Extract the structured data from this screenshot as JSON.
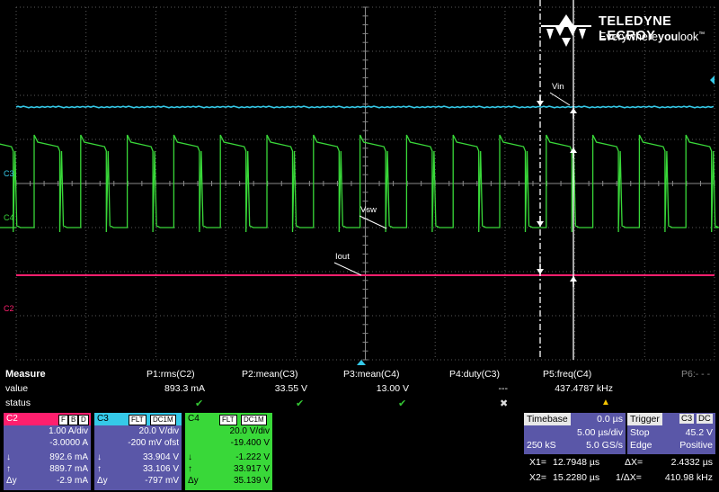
{
  "brand": {
    "name": "TELEDYNE LECROY",
    "tagline_pre": "Everywhere",
    "tagline_bold": "you",
    "tagline_post": "look",
    "tagline_tm": "™"
  },
  "colors": {
    "c2": "#ff1f6e",
    "c3": "#35c9e8",
    "c4": "#39d839",
    "grid": "#5a5a5a",
    "panel": "#5a57a8"
  },
  "traces": {
    "c3_label": "C3",
    "c4_label": "C4",
    "c2_label": "C2",
    "vin_label": "Vin",
    "vsw_label": "Vsw",
    "iout_label": "Iout"
  },
  "measure": {
    "title": "Measure",
    "row_value": "value",
    "row_status": "status",
    "params": [
      {
        "name": "P1:rms(C2)",
        "value": "893.3 mA",
        "status": "check"
      },
      {
        "name": "P2:mean(C3)",
        "value": "33.55 V",
        "status": "check"
      },
      {
        "name": "P3:mean(C4)",
        "value": "13.00 V",
        "status": "check"
      },
      {
        "name": "P4:duty(C3)",
        "value": "---",
        "status": "cross"
      },
      {
        "name": "P5:freq(C4)",
        "value": "437.4787 kHz",
        "status": "warn"
      },
      {
        "name": "P6:- - -",
        "value": "",
        "status": ""
      }
    ]
  },
  "channels": [
    {
      "name": "C2",
      "badges": [
        "F",
        "B",
        "D"
      ],
      "vdiv": "1.00 A/div",
      "offset": "-3.0000 A",
      "down": "892.6 mA",
      "up": "889.7 mA",
      "delta": "-2.9 mA"
    },
    {
      "name": "C3",
      "badges": [
        "FLT",
        "DC1M"
      ],
      "vdiv": "20.0 V/div",
      "offset": "-200 mV ofst",
      "down": "33.904 V",
      "up": "33.106 V",
      "delta": "-797 mV"
    },
    {
      "name": "C4",
      "badges": [
        "FLT",
        "DC1M"
      ],
      "vdiv": "20.0 V/div",
      "offset": "-19.400 V",
      "down": "-1.222 V",
      "up": "33.917 V",
      "delta": "35.139 V"
    }
  ],
  "symbols": {
    "down": "↓",
    "up": "↑",
    "delta": "Δy"
  },
  "timebase": {
    "title": "Timebase",
    "delay": "0.0 µs",
    "tdiv": "5.00 µs/div",
    "samples": "250 kS",
    "rate": "5.0 GS/s"
  },
  "trigger": {
    "title": "Trigger",
    "source": "C3",
    "coupling": "DC",
    "mode": "Stop",
    "level": "45.2 V",
    "type": "Edge",
    "slope": "Positive"
  },
  "cursors": {
    "x1_label": "X1=",
    "x1": "12.7948 µs",
    "dx_label": "ΔX=",
    "dx": "2.4332 µs",
    "x2_label": "X2=",
    "x2": "15.2280 µs",
    "inv_dx_label": "1/ΔX=",
    "inv_dx": "410.98 kHz"
  }
}
